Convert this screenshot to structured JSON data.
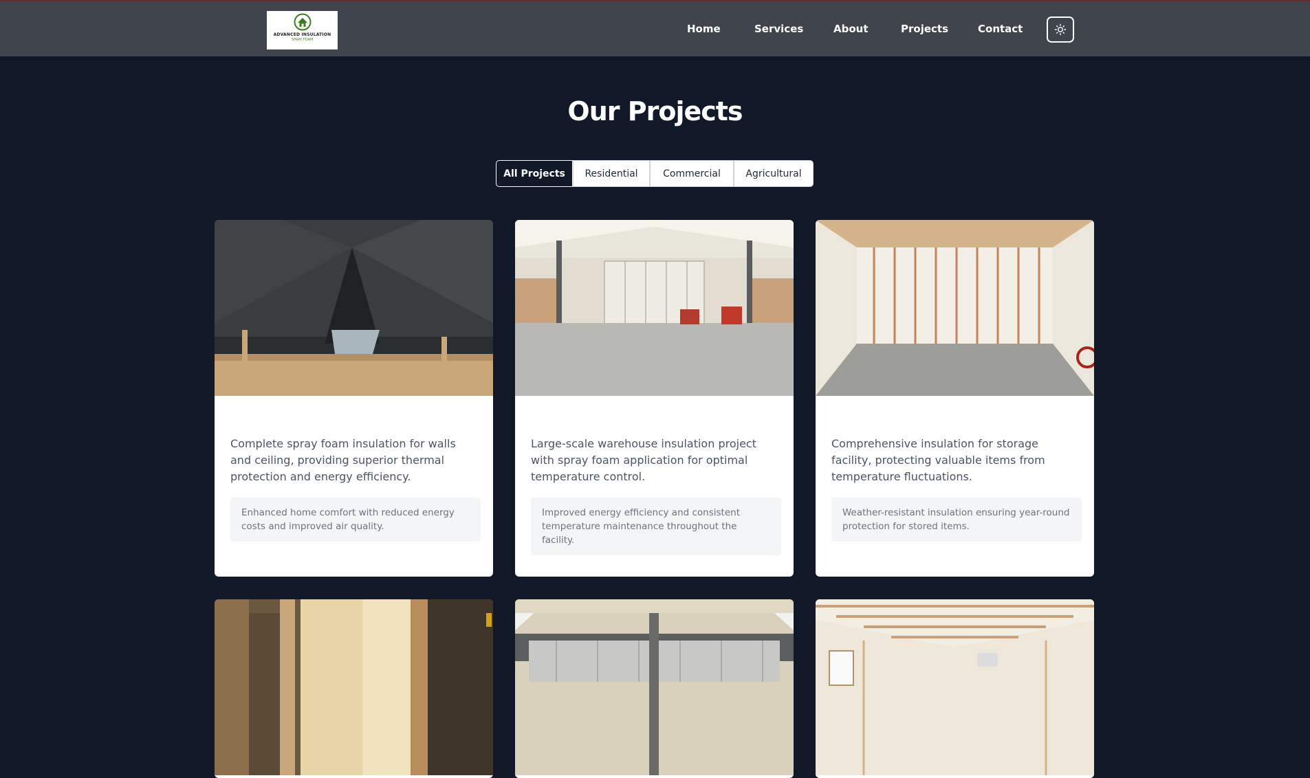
{
  "brand": {
    "name": "ADVANCED INSULATION",
    "tagline": "SPRAY FOAM"
  },
  "nav": {
    "links": [
      "Home",
      "Services",
      "About",
      "Projects",
      "Contact"
    ],
    "theme_toggle_icon": "sun-icon"
  },
  "page": {
    "title": "Our Projects"
  },
  "filters": [
    "All Projects",
    "Residential",
    "Commercial",
    "Agricultural"
  ],
  "active_filter": "All Projects",
  "projects": [
    {
      "image": "attic-black-spray-foam-photo",
      "description": "Complete spray foam insulation for walls and ceiling, providing superior thermal protection and energy efficiency.",
      "result": "Enhanced home comfort with reduced energy costs and improved air quality."
    },
    {
      "image": "warehouse-interior-photo",
      "description": "Large-scale warehouse insulation project with spray foam application for optimal temperature control.",
      "result": "Improved energy efficiency and consistent temperature maintenance throughout the facility."
    },
    {
      "image": "storage-room-foam-walls-photo",
      "description": "Comprehensive insulation for storage facility, protecting valuable items from temperature fluctuations.",
      "result": "Weather-resistant insulation ensuring year-round protection for stored items."
    },
    {
      "image": "wood-framed-walls-foam-photo"
    },
    {
      "image": "metal-building-foam-ceiling-photo"
    },
    {
      "image": "shed-interior-foam-photo"
    }
  ],
  "colors": {
    "background": "#111827",
    "navbar": "#3f444d",
    "card": "#ffffff",
    "text_muted": "#4b5563",
    "result_bg": "#f4f5f7",
    "logo_green": "#4a8a2a"
  }
}
